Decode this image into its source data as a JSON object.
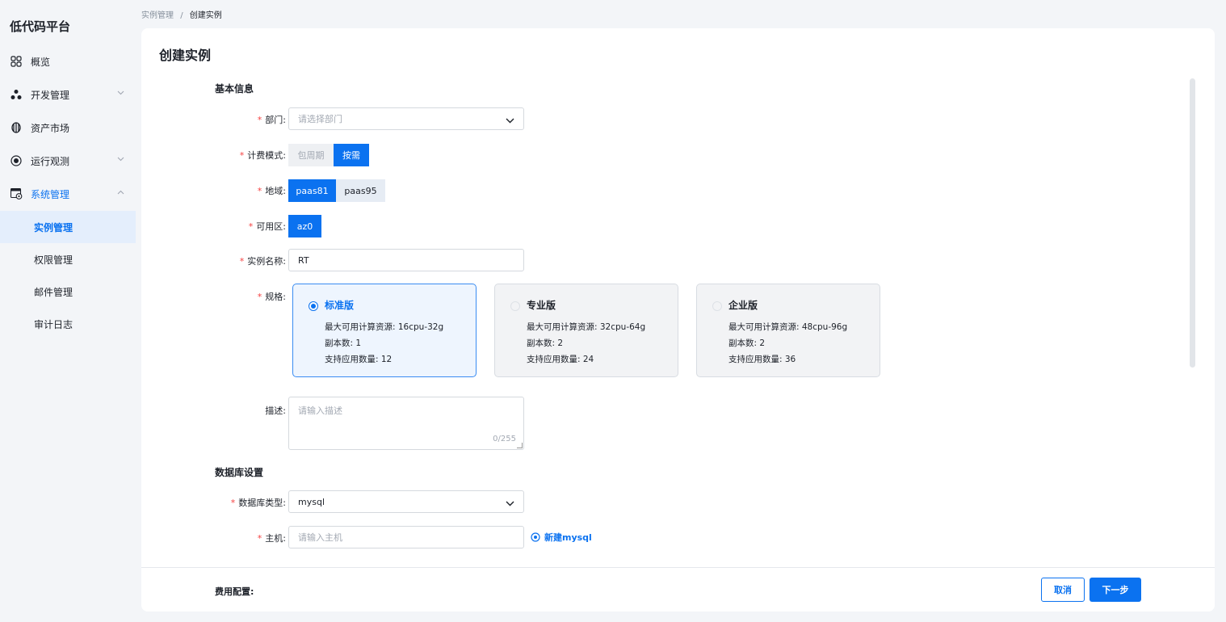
{
  "app": {
    "title": "低代码平台"
  },
  "nav": {
    "overview": "概览",
    "dev": "开发管理",
    "assets": "资产市场",
    "ops": "运行观测",
    "system": "系统管理",
    "sub": [
      "实例管理",
      "权限管理",
      "邮件管理",
      "审计日志"
    ]
  },
  "breadcrumb": {
    "parent": "实例管理",
    "sep": "/",
    "current": "创建实例"
  },
  "page": {
    "title": "创建实例"
  },
  "form": {
    "basic_title": "基本信息",
    "dept": {
      "label": "部门:",
      "placeholder": "请选择部门"
    },
    "billing": {
      "label": "计费模式:",
      "options": [
        "包周期",
        "按需"
      ],
      "selected": "按需"
    },
    "region": {
      "label": "地域:",
      "options": [
        "paas81",
        "paas95"
      ],
      "selected": "paas81"
    },
    "zone": {
      "label": "可用区:",
      "options": [
        "az0"
      ],
      "selected": "az0"
    },
    "name": {
      "label": "实例名称:",
      "value": "RT"
    },
    "spec": {
      "label": "规格:",
      "selected": "标准版",
      "cards": [
        {
          "name": "标准版",
          "resource": "最大可用计算资源: 16cpu-32g",
          "replicas": "副本数: 1",
          "apps": "支持应用数量: 12"
        },
        {
          "name": "专业版",
          "resource": "最大可用计算资源: 32cpu-64g",
          "replicas": "副本数: 2",
          "apps": "支持应用数量: 24"
        },
        {
          "name": "企业版",
          "resource": "最大可用计算资源: 48cpu-96g",
          "replicas": "副本数: 2",
          "apps": "支持应用数量: 36"
        }
      ]
    },
    "desc": {
      "label": "描述:",
      "placeholder": "请输入描述",
      "count": "0/255"
    },
    "db_title": "数据库设置",
    "db_type": {
      "label": "数据库类型:",
      "value": "mysql"
    },
    "host": {
      "label": "主机:",
      "placeholder": "请输入主机",
      "new_link": "新建mysql"
    }
  },
  "footer": {
    "fee_label": "费用配置:",
    "cancel": "取消",
    "next": "下一步"
  },
  "colors": {
    "primary": "#0b72f0",
    "required": "#f53f3f",
    "background": "#f3f5f8"
  }
}
